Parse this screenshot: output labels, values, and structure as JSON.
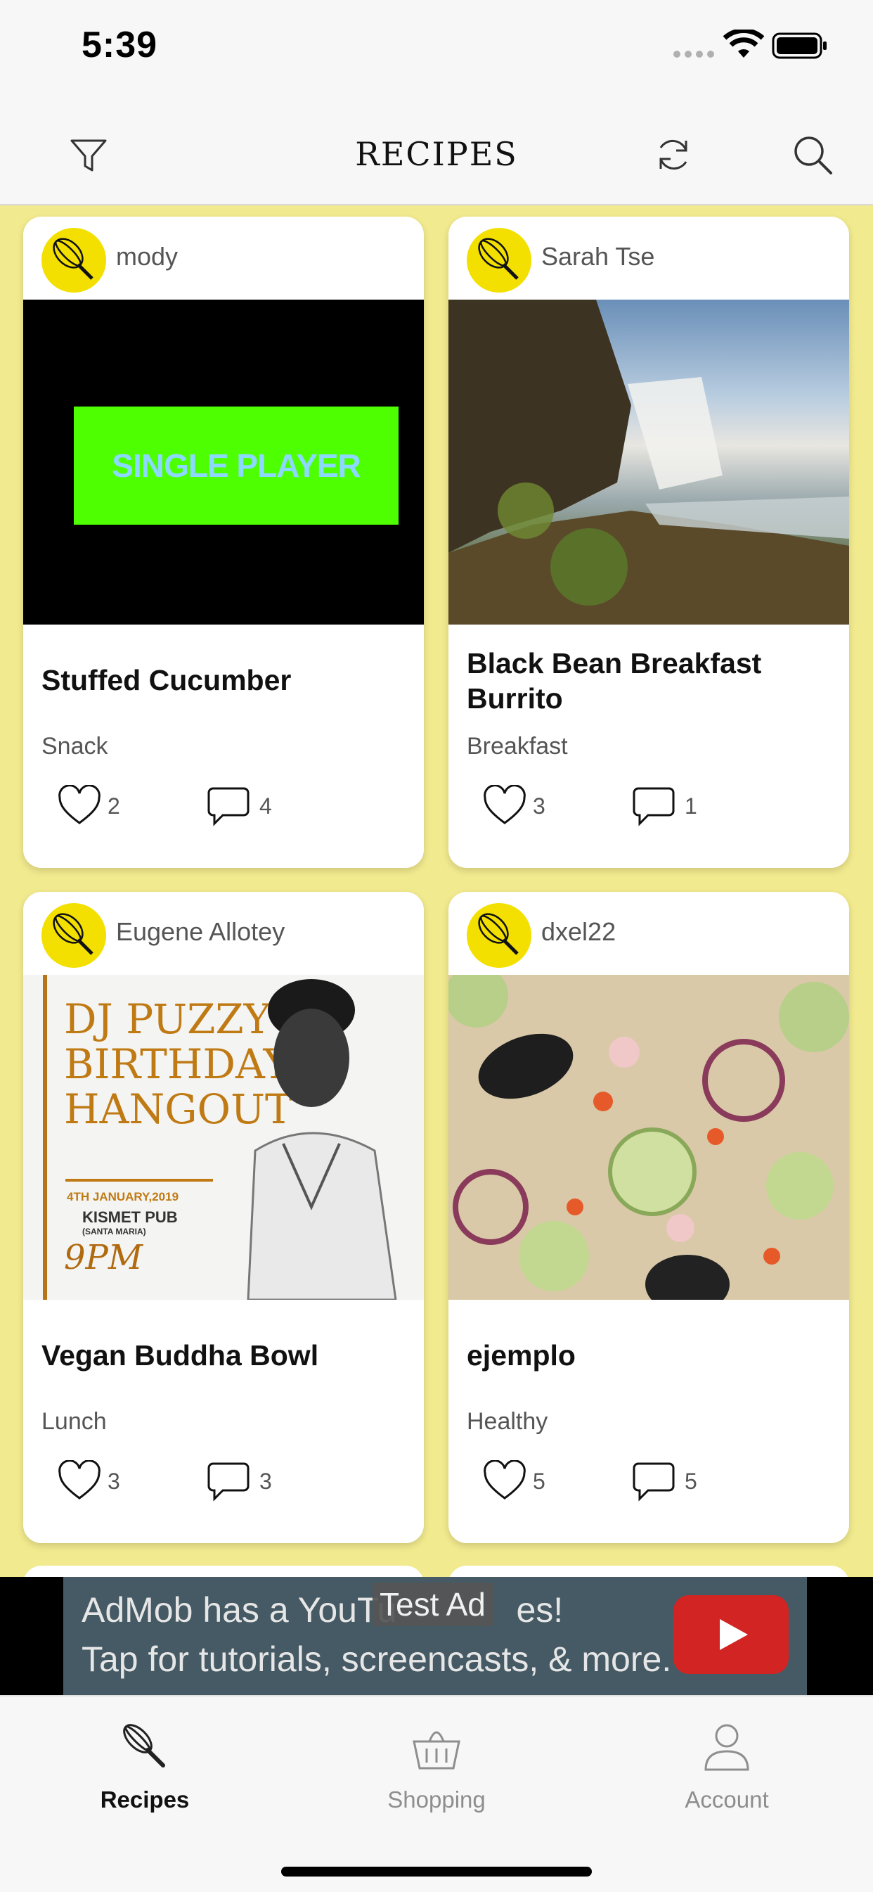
{
  "status_bar": {
    "time": "5:39"
  },
  "nav": {
    "title": "RECIPES"
  },
  "recipes": [
    {
      "author": "mody",
      "title": "Stuffed Cucumber",
      "category": "Snack",
      "likes": "2",
      "comments": "4",
      "image_text": "SINGLE PLAYER"
    },
    {
      "author": "Sarah Tse",
      "title": "Black Bean Breakfast Burrito",
      "category": "Breakfast",
      "likes": "3",
      "comments": "1"
    },
    {
      "author": "Eugene Allotey",
      "title": "Vegan Buddha Bowl",
      "category": "Lunch",
      "likes": "3",
      "comments": "3",
      "poster": {
        "line1": "DJ PUZZY",
        "line2": "BIRTHDAY",
        "line3": "HANGOUT",
        "date": "4TH JANUARY,2019",
        "venue": "KISMET PUB",
        "venue_sub": "(SANTA MARIA)",
        "time": "9PM"
      }
    },
    {
      "author": "dxel22",
      "title": "ejemplo",
      "category": "Healthy",
      "likes": "5",
      "comments": "5"
    }
  ],
  "ad": {
    "line1": "AdMob has a YouTube channel with videos!",
    "line1_visible": "AdMob has a YouTu",
    "line1_end": "es!",
    "line2": "Tap for tutorials, screencasts, & more.",
    "badge": "Test Ad"
  },
  "tabs": [
    {
      "label": "Recipes",
      "active": true
    },
    {
      "label": "Shopping",
      "active": false
    },
    {
      "label": "Account",
      "active": false
    }
  ],
  "colors": {
    "feed_bg": "#f2ea8e",
    "avatar": "#f3e000",
    "ad_bg": "#455a64",
    "tab_active": "#111111",
    "tab_inactive": "#8e8e8e"
  }
}
